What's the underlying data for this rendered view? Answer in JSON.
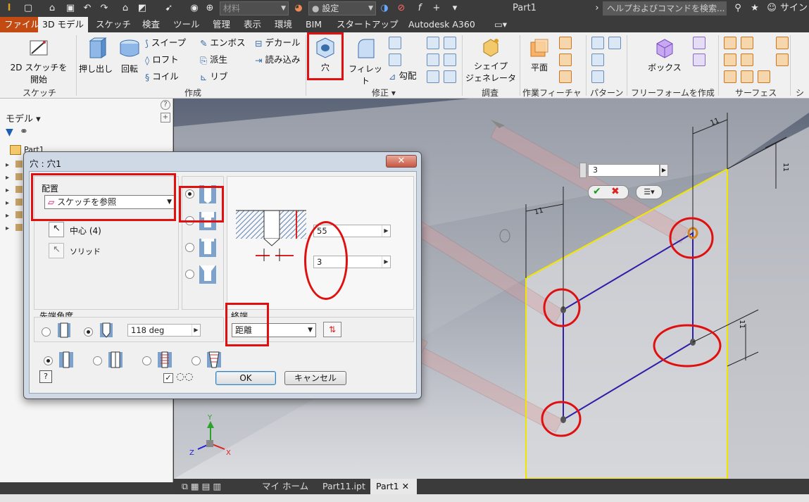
{
  "titlebar": {
    "material_placeholder": "材料",
    "appearance_value": "設定",
    "document_title": "Part1",
    "help_search_placeholder": "ヘルプおよびコマンドを検索...",
    "signin": "サイン"
  },
  "tabs": [
    "ファイル",
    "3D モデル",
    "スケッチ",
    "検査",
    "ツール",
    "管理",
    "表示",
    "環境",
    "BIM",
    "スタートアップ",
    "Autodesk A360"
  ],
  "ribbon": {
    "sketch": {
      "start_sketch_line1": "2D スケッチを",
      "start_sketch_line2": "開始",
      "group": "スケッチ"
    },
    "create": {
      "extrude": "押し出し",
      "revolve": "回転",
      "sweep": "スイープ",
      "loft": "ロフト",
      "coil": "コイル",
      "emboss": "エンボス",
      "derive": "派生",
      "rib": "リブ",
      "decal": "デカール",
      "import": "読み込み",
      "group": "作成"
    },
    "modify": {
      "hole": "穴",
      "fillet": "フィレット",
      "draft": "勾配",
      "group": "修正"
    },
    "explore": {
      "shape_gen_line1": "シェイプ",
      "shape_gen_line2": "ジェネレータ",
      "group": "調査"
    },
    "work_features": {
      "plane": "平面",
      "group": "作業フィーチャ"
    },
    "pattern": {
      "group": "パターン"
    },
    "freeform": {
      "box": "ボックス",
      "group": "フリーフォームを作成"
    },
    "surface": {
      "group": "サーフェス"
    },
    "more": {
      "group": "シ"
    }
  },
  "browser": {
    "header": "モデル",
    "root": "Part1"
  },
  "viewport": {
    "mini_value": "3",
    "dims": [
      "11",
      "11",
      "11",
      "11"
    ]
  },
  "dialog": {
    "title": "穴 : 穴1",
    "placement_label": "配置",
    "placement_value": "スケッチを参照",
    "centers": "中心 (4)",
    "solid": "ソリッド",
    "depth_value": "55",
    "diameter_value": "3",
    "termination_label": "終端",
    "termination_value": "距離",
    "drill_point_label": "先端角度",
    "drill_angle": "118 deg",
    "ok": "OK",
    "cancel": "キャンセル",
    "help": "?"
  },
  "doc_tabs": [
    "マイ ホーム",
    "Part11.ipt",
    "Part1"
  ],
  "colors": {
    "file_tab": "#c34a10",
    "annotation": "#e01010",
    "sketch_line": "#2e1fa8",
    "selection": "#f2e600"
  }
}
